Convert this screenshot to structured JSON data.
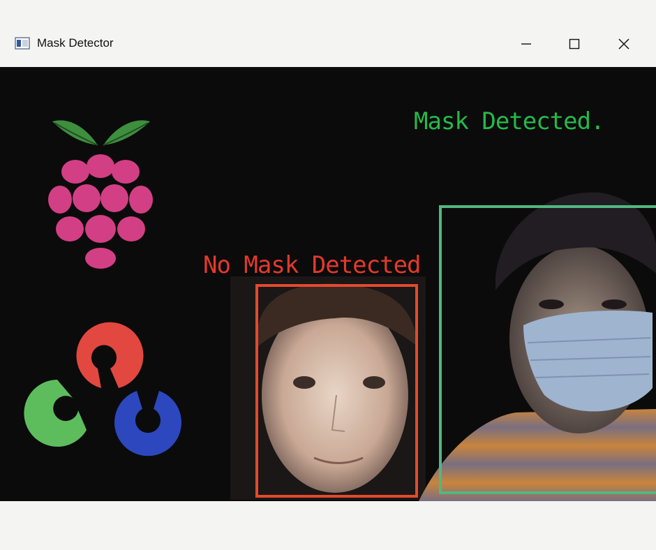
{
  "window": {
    "title": "Mask Detector",
    "controls": {
      "minimize": "minimize-icon",
      "maximize": "maximize-icon",
      "close": "close-icon"
    }
  },
  "video": {
    "labels": {
      "mask": "Mask Detected.",
      "no_mask": "No Mask Detected"
    },
    "colors": {
      "mask": "#25b94a",
      "no_mask": "#e4392c",
      "mask_box": "#50b882",
      "no_mask_box": "#e24a2e"
    },
    "logos": [
      "raspberry-pi-logo",
      "opencv-logo"
    ]
  }
}
